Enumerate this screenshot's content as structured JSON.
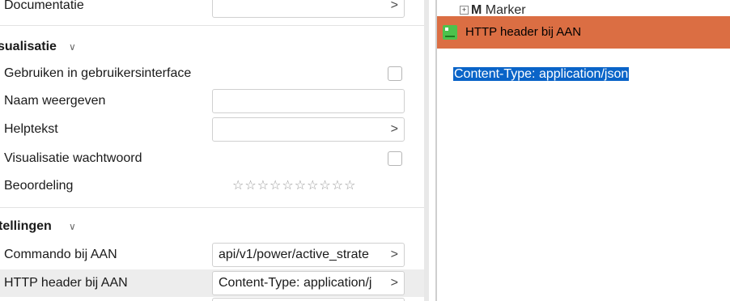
{
  "properties": {
    "documentatie": {
      "label": "Documentatie",
      "value": "",
      "arrow": ">"
    },
    "visualisatie_section": {
      "label": "sualisatie",
      "chevron": "∨"
    },
    "gebruiken_ui": {
      "label": "Gebruiken in gebruikersinterface",
      "checked": false
    },
    "naam_weergeven": {
      "label": "Naam weergeven",
      "value": ""
    },
    "helptekst": {
      "label": "Helptekst",
      "value": "",
      "arrow": ">"
    },
    "visualisatie_wachtwoord": {
      "label": "Visualisatie wachtwoord",
      "checked": false
    },
    "beoordeling": {
      "label": "Beoordeling",
      "stars": "☆☆☆☆☆☆☆☆☆☆",
      "rating": 0,
      "max": 10
    },
    "instellingen_section": {
      "label": "tellingen",
      "chevron": "∨"
    },
    "commando_aan": {
      "label": "Commando bij AAN",
      "value": "api/v1/power/active_strate",
      "arrow": ">"
    },
    "http_header_aan": {
      "label": "HTTP header bij AAN",
      "value": "Content-Type: application/j",
      "arrow": ">"
    }
  },
  "tree": {
    "expander": "+",
    "prefix": "M",
    "label": "Marker"
  },
  "popup": {
    "title": "HTTP header bij AAN",
    "content": "Content-Type: application/json"
  },
  "colors": {
    "titlebar": "#db6e43",
    "selection": "#0a64c8",
    "selected_row": "#ededed",
    "app_icon": "#4cc24c"
  }
}
